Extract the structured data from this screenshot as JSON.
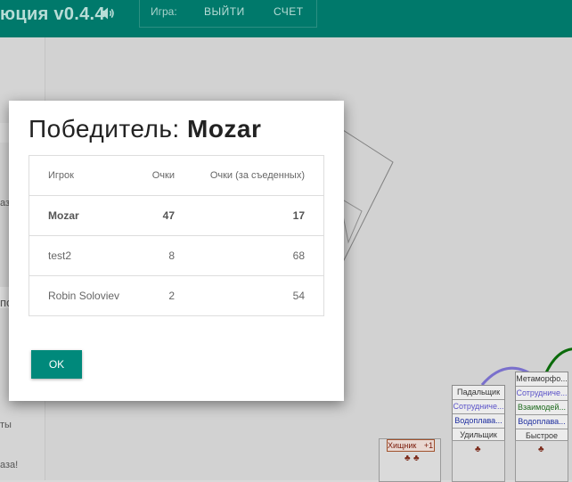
{
  "header": {
    "title": "юция v0.4.4",
    "sound_icon": "speaker-icon",
    "game_label": "Игра:",
    "exit_label": "ВЫЙТИ",
    "score_label": "СЧЕТ"
  },
  "left_panel": {
    "texts": [
      "аз",
      "по",
      "ты",
      "аза!"
    ]
  },
  "board": {
    "cards": [
      {
        "rows": [
          "Падальщик",
          "Сотрудниче...",
          "Водоплава..."
        ],
        "colors": [
          "#333",
          "#5a52c8",
          "#1e2ea0"
        ],
        "bottom": "Удильщик"
      },
      {
        "rows": [
          "Метаморфо...",
          "Сотрудниче...",
          "Взаимодей...",
          "Водоплава..."
        ],
        "colors": [
          "#333",
          "#5a52c8",
          "#1e6b1e",
          "#1e2ea0"
        ],
        "bottom": "Быстрое"
      }
    ],
    "predator_label": "Хищник",
    "predator_bonus": "+1"
  },
  "modal": {
    "title_prefix": "Победитель: ",
    "winner": "Mozar",
    "columns": [
      "Игрок",
      "Очки",
      "Очки (за съеденных)"
    ],
    "rows": [
      {
        "player": "Mozar",
        "points": "47",
        "eaten_points": "17"
      },
      {
        "player": "test2",
        "points": "8",
        "eaten_points": "68"
      },
      {
        "player": "Robin Soloviev",
        "points": "2",
        "eaten_points": "54"
      }
    ],
    "ok_label": "OK"
  },
  "colors": {
    "header_bg": "#00796b",
    "accent": "#00897b"
  }
}
